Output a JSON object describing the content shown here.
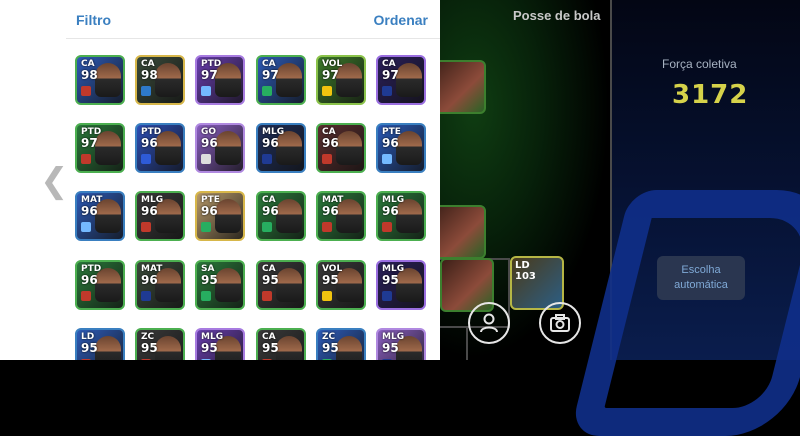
{
  "filter_label": "Filtro",
  "sort_label": "Ordenar",
  "team_strength": {
    "label": "Força coletiva",
    "value": "3172"
  },
  "possession_label": "Posse de bola",
  "auto_select_label": [
    "Escolha",
    "automática"
  ],
  "field_cards": [
    {
      "pos": "",
      "ovr": ""
    },
    {
      "pos": "LD",
      "ovr": "103"
    }
  ],
  "cards": [
    {
      "pos": "CA",
      "ovr": "98",
      "bg": "#2d5bb8",
      "border": "#4caf50",
      "badge": "#c0392b"
    },
    {
      "pos": "CA",
      "ovr": "98",
      "bg": "#3a4a3a",
      "border": "#d7b74a",
      "badge": "#2e7ac9"
    },
    {
      "pos": "PTD",
      "ovr": "97",
      "bg": "#6a3fb0",
      "border": "#a77be0",
      "badge": "#74b9ff"
    },
    {
      "pos": "CA",
      "ovr": "97",
      "bg": "#2d5bb8",
      "border": "#4caf50",
      "badge": "#27ae60"
    },
    {
      "pos": "VOL",
      "ovr": "97",
      "bg": "#3d7a2a",
      "border": "#8bc34a",
      "badge": "#f1c40f"
    },
    {
      "pos": "CA",
      "ovr": "97",
      "bg": "#2a1f5a",
      "border": "#9a6ee0",
      "badge": "#1f3a93"
    },
    {
      "pos": "PTD",
      "ovr": "97",
      "bg": "#2a7a3a",
      "border": "#4caf50",
      "badge": "#c0392b"
    },
    {
      "pos": "PTD",
      "ovr": "96",
      "bg": "#2d4fb8",
      "border": "#3a7fc0",
      "badge": "#2e5bd8"
    },
    {
      "pos": "GO",
      "ovr": "96",
      "bg": "#8a5fc0",
      "border": "#b089e0",
      "badge": "#dddddd"
    },
    {
      "pos": "MLG",
      "ovr": "96",
      "bg": "#1f2f5a",
      "border": "#3a7fc0",
      "badge": "#1f3a93"
    },
    {
      "pos": "CA",
      "ovr": "96",
      "bg": "#5a2e2e",
      "border": "#4caf50",
      "badge": "#c0392b"
    },
    {
      "pos": "PTE",
      "ovr": "96",
      "bg": "#2a5ab8",
      "border": "#3a7fc0",
      "badge": "#74b9ff"
    },
    {
      "pos": "MAT",
      "ovr": "96",
      "bg": "#2d5bb8",
      "border": "#3a7fc0",
      "badge": "#74b9ff"
    },
    {
      "pos": "MLG",
      "ovr": "96",
      "bg": "#3a3a3a",
      "border": "#4caf50",
      "badge": "#c0392b"
    },
    {
      "pos": "PTE",
      "ovr": "96",
      "bg": "#b89a6a",
      "border": "#d7b74a",
      "badge": "#27ae60"
    },
    {
      "pos": "CA",
      "ovr": "96",
      "bg": "#2a7a3a",
      "border": "#4caf50",
      "badge": "#27ae60"
    },
    {
      "pos": "MAT",
      "ovr": "96",
      "bg": "#2a7a3a",
      "border": "#4caf50",
      "badge": "#c0392b"
    },
    {
      "pos": "MLG",
      "ovr": "96",
      "bg": "#2a7a3a",
      "border": "#4caf50",
      "badge": "#c0392b"
    },
    {
      "pos": "PTD",
      "ovr": "96",
      "bg": "#2a7a3a",
      "border": "#4caf50",
      "badge": "#c0392b"
    },
    {
      "pos": "MAT",
      "ovr": "96",
      "bg": "#3a4a3a",
      "border": "#4caf50",
      "badge": "#1f3a93"
    },
    {
      "pos": "SA",
      "ovr": "95",
      "bg": "#2a7a3a",
      "border": "#4caf50",
      "badge": "#27ae60"
    },
    {
      "pos": "CA",
      "ovr": "95",
      "bg": "#3a3a3a",
      "border": "#4caf50",
      "badge": "#c0392b"
    },
    {
      "pos": "VOL",
      "ovr": "95",
      "bg": "#3a3a3a",
      "border": "#4caf50",
      "badge": "#f1c40f"
    },
    {
      "pos": "MLG",
      "ovr": "95",
      "bg": "#2a1f5a",
      "border": "#9a6ee0",
      "badge": "#1f3a93"
    },
    {
      "pos": "LD",
      "ovr": "95",
      "bg": "#2d5bb8",
      "border": "#3a7fc0",
      "badge": "#c0392b"
    },
    {
      "pos": "ZC",
      "ovr": "95",
      "bg": "#3a3a3a",
      "border": "#4caf50",
      "badge": "#c0392b"
    },
    {
      "pos": "MLG",
      "ovr": "95",
      "bg": "#6a3fb0",
      "border": "#a77be0",
      "badge": "#74b9ff"
    },
    {
      "pos": "CA",
      "ovr": "95",
      "bg": "#3a3a3a",
      "border": "#4caf50",
      "badge": "#c0392b"
    },
    {
      "pos": "ZC",
      "ovr": "95",
      "bg": "#2d5bb8",
      "border": "#3a7fc0",
      "badge": "#27ae60"
    },
    {
      "pos": "MLG",
      "ovr": "95",
      "bg": "#8a5fc0",
      "border": "#b089e0",
      "badge": "#1f3a93"
    }
  ]
}
